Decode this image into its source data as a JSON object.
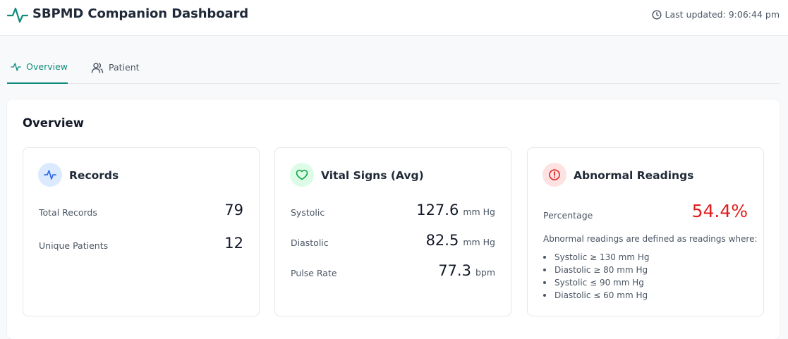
{
  "header": {
    "title": "SBPMD Companion Dashboard",
    "last_updated": "Last updated: 9:06:44 pm",
    "logo_icon": "activity-icon",
    "clock_icon": "clock-icon"
  },
  "tabs": [
    {
      "label": "Overview",
      "icon": "activity-icon",
      "active": true
    },
    {
      "label": "Patient",
      "icon": "users-icon",
      "active": false
    }
  ],
  "overview": {
    "title": "Overview",
    "records": {
      "title": "Records",
      "icon": "activity-icon",
      "rows": [
        {
          "label": "Total Records",
          "value": "79"
        },
        {
          "label": "Unique Patients",
          "value": "12"
        }
      ]
    },
    "vitals": {
      "title": "Vital Signs (Avg)",
      "icon": "heart-icon",
      "rows": [
        {
          "label": "Systolic",
          "value": "127.6",
          "unit": "mm Hg"
        },
        {
          "label": "Diastolic",
          "value": "82.5",
          "unit": "mm Hg"
        },
        {
          "label": "Pulse Rate",
          "value": "77.3",
          "unit": "bpm"
        }
      ]
    },
    "abnormal": {
      "title": "Abnormal Readings",
      "icon": "alert-circle-icon",
      "percentage_label": "Percentage",
      "percentage_value": "54.4%",
      "definition": "Abnormal readings are defined as readings where:",
      "criteria": [
        "Systolic ≥ 130 mm Hg",
        "Diastolic ≥ 80 mm Hg",
        "Systolic ≤ 90 mm Hg",
        "Diastolic ≤ 60 mm Hg"
      ]
    }
  },
  "colors": {
    "accent": "#0f8a7c",
    "records_icon_bg": "#dbeafe",
    "records_icon": "#2563eb",
    "vitals_icon_bg": "#dcfce7",
    "vitals_icon": "#16a34a",
    "abnormal_icon_bg": "#fee2e2",
    "abnormal_icon": "#dc2626",
    "danger": "#e11d1d"
  }
}
